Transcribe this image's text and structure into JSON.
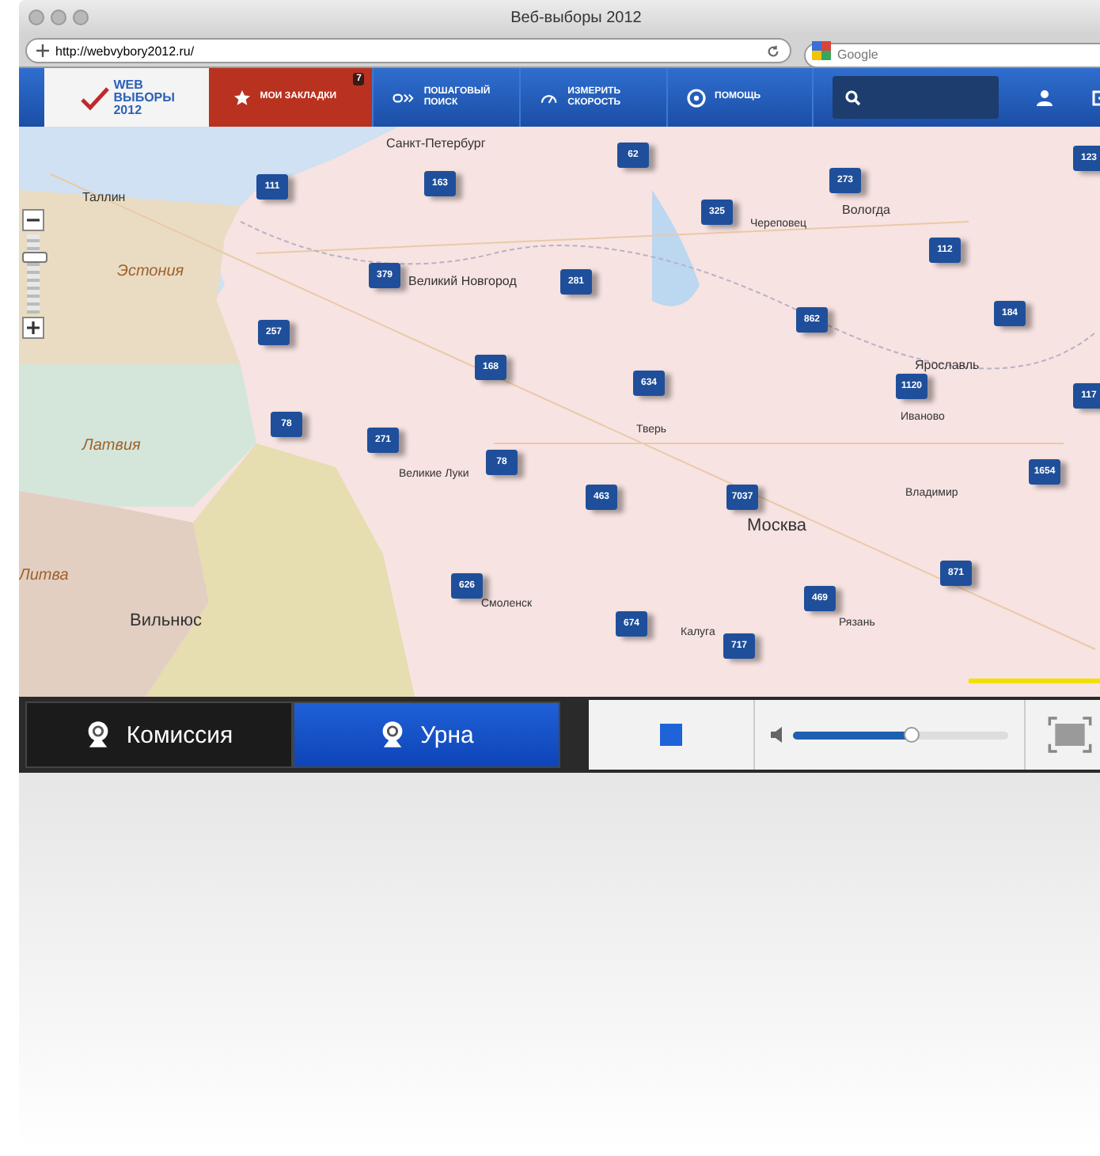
{
  "window": {
    "title": "Веб-выборы 2012"
  },
  "address_bar": {
    "url": "http://webvybory2012.ru/",
    "search_placeholder": "Google"
  },
  "nav": {
    "logo": [
      "WEB",
      "ВЫБОРЫ",
      "2012"
    ],
    "items": [
      {
        "kind": "bookmarks",
        "label": "МОИ ЗАКЛАДКИ",
        "badge": "7",
        "selected": true
      },
      {
        "kind": "search",
        "label": "ПОШАГОВЫЙ ПОИСК",
        "selected": false
      },
      {
        "kind": "speed",
        "label": "ИЗМЕРИТЬ СКОРОСТЬ",
        "selected": false
      },
      {
        "kind": "help",
        "label": "ПОМОЩЬ",
        "selected": false
      }
    ]
  },
  "map": {
    "zoom": {
      "level": 0.75
    },
    "places": [
      {
        "kind": "city",
        "name": "Санкт-Петербург"
      },
      {
        "kind": "city",
        "name": "Таллин"
      },
      {
        "kind": "country",
        "name": "Эстония"
      },
      {
        "kind": "city",
        "name": "Великий Новгород"
      },
      {
        "kind": "city",
        "name": "Вологда"
      },
      {
        "kind": "town",
        "name": "Череповец"
      },
      {
        "kind": "city",
        "name": "Ярославль"
      },
      {
        "kind": "town",
        "name": "Тверь"
      },
      {
        "kind": "town",
        "name": "Иваново"
      },
      {
        "kind": "country",
        "name": "Латвия"
      },
      {
        "kind": "capital",
        "name": "Москва"
      },
      {
        "kind": "town",
        "name": "Владимир"
      },
      {
        "kind": "town",
        "name": "Смоленск"
      },
      {
        "kind": "capital",
        "name": "Вильнюс"
      },
      {
        "kind": "town",
        "name": "Калуга"
      },
      {
        "kind": "town",
        "name": "Рязань"
      },
      {
        "kind": "town",
        "name": "Великие Луки"
      },
      {
        "kind": "country",
        "name": "Литва"
      }
    ],
    "markers": [
      "62",
      "123",
      "111",
      "163",
      "273",
      "325",
      "112",
      "379",
      "281",
      "257",
      "862",
      "184",
      "168",
      "634",
      "1120",
      "117",
      "78",
      "271",
      "78",
      "1654",
      "463",
      "7037",
      "626",
      "469",
      "871",
      "674",
      "717"
    ]
  },
  "player": {
    "tabs": [
      {
        "label": "Комиссия",
        "selected": false
      },
      {
        "label": "Урна",
        "selected": true
      }
    ],
    "volume": {
      "level": 0.55
    }
  }
}
